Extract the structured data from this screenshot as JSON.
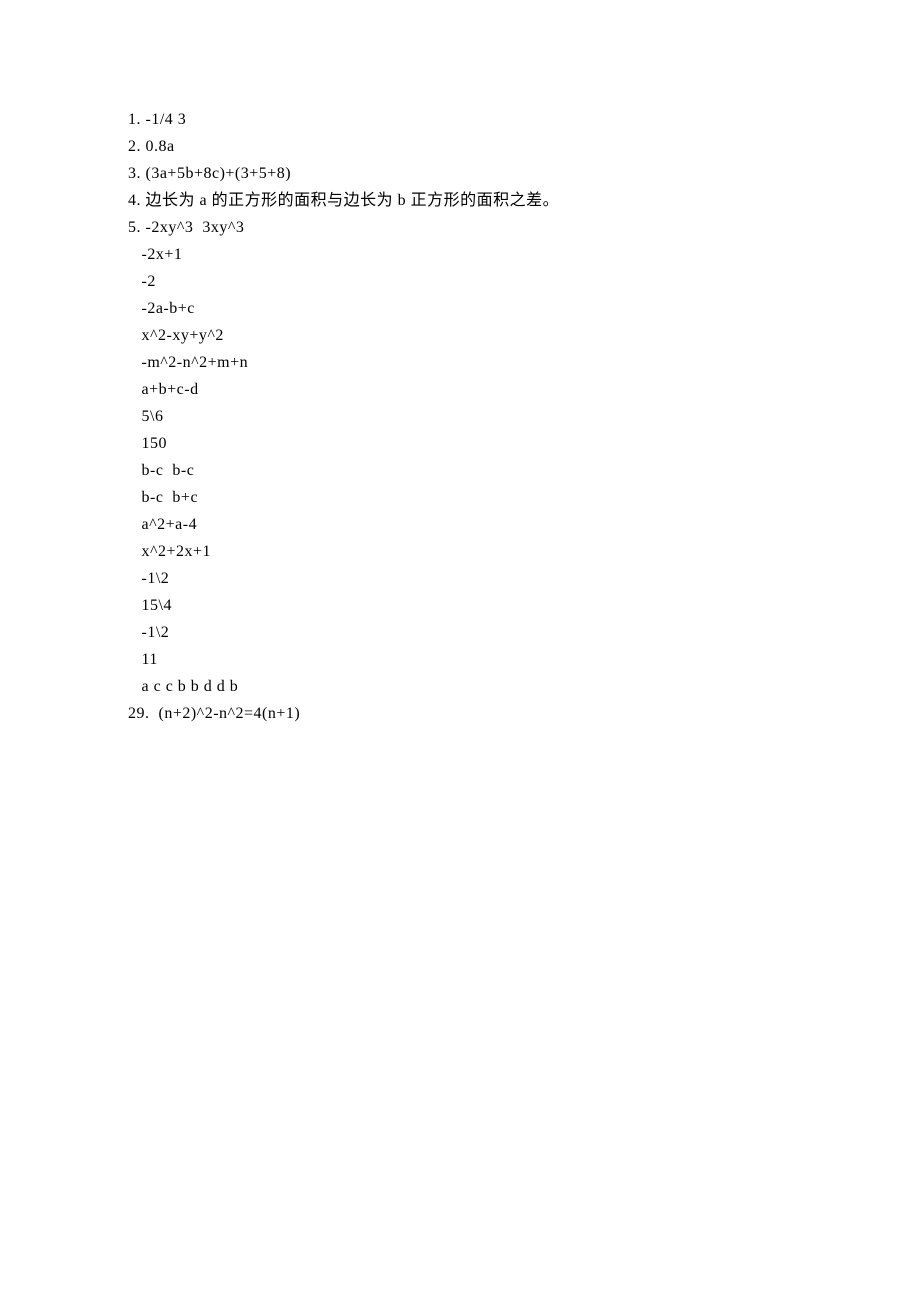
{
  "lines": [
    "1. -1/4 3",
    "2. 0.8a",
    "3. (3a+5b+8c)+(3+5+8)",
    "4. 边长为 a 的正方形的面积与边长为 b 正方形的面积之差。",
    "5. -2xy^3  3xy^3",
    "   -2x+1",
    "   -2",
    "   -2a-b+c",
    "   x^2-xy+y^2",
    "   -m^2-n^2+m+n",
    "   a+b+c-d",
    "   5\\6",
    "   150",
    "   b-c  b-c",
    "   b-c  b+c",
    "   a^2+a-4",
    "   x^2+2x+1",
    "   -1\\2",
    "   15\\4",
    "   -1\\2",
    "   11",
    "   a c c b b d d b",
    "29.  (n+2)^2-n^2=4(n+1)"
  ]
}
